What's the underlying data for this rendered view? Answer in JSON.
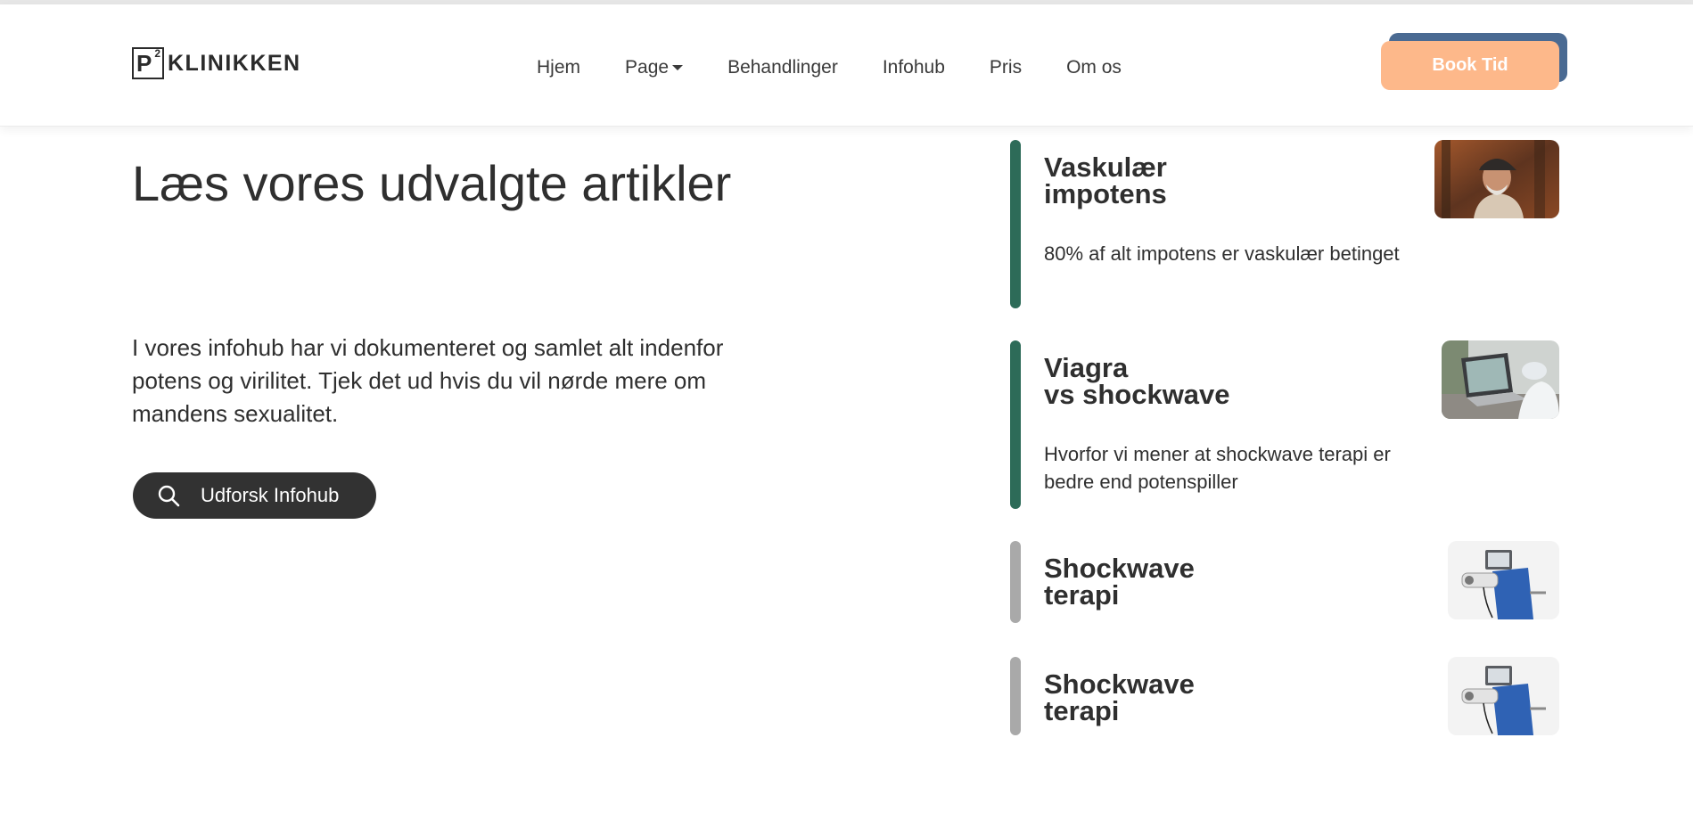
{
  "header": {
    "logo": {
      "mark": "P",
      "superscript": "2",
      "text": "KLINIKKEN"
    },
    "nav": [
      {
        "label": "Hjem",
        "dropdown": false
      },
      {
        "label": "Page",
        "dropdown": true
      },
      {
        "label": "Behandlinger",
        "dropdown": false
      },
      {
        "label": "Infohub",
        "dropdown": false
      },
      {
        "label": "Pris",
        "dropdown": false
      },
      {
        "label": "Om os",
        "dropdown": false
      }
    ],
    "cta_label": "Book Tid"
  },
  "hero": {
    "title": "Læs vores udvalgte artikler",
    "text": "I vores infohub har vi dokumenteret og samlet alt indenfor potens og virilitet. Tjek det ud hvis du vil nørde mere om mandens sexualitet.",
    "button_label": "Udforsk Infohub",
    "button_icon": "search-icon"
  },
  "articles": [
    {
      "title_line1": "Vaskulær",
      "title_line2": "impotens",
      "description": "80% af alt impotens er vaskulær betinget",
      "active": true,
      "image": "man-with-cap-portrait"
    },
    {
      "title_line1": "Viagra",
      "title_line2": "vs shockwave",
      "description": "Hvorfor vi mener at shockwave terapi er bedre end potenspiller",
      "active": true,
      "image": "laptop-consultation"
    },
    {
      "title_line1": "Shockwave",
      "title_line2": "terapi",
      "description": "",
      "active": false,
      "image": "shockwave-device"
    },
    {
      "title_line1": "Shockwave",
      "title_line2": "terapi",
      "description": "",
      "active": false,
      "image": "shockwave-device"
    }
  ],
  "colors": {
    "accent_bar": "#2d6b58",
    "inactive_bar": "#a9a9a9",
    "cta": "#fdb88a",
    "cta_shadow": "#4a6a92",
    "dark_button": "#323232"
  }
}
